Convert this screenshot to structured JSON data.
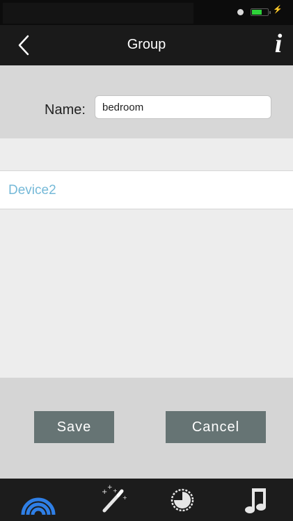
{
  "header": {
    "title": "Group",
    "back_icon": "chevron-left-icon",
    "info_glyph": "i"
  },
  "form": {
    "name_label": "Name:",
    "name_value": "bedroom"
  },
  "devices": [
    {
      "label": "Device2"
    }
  ],
  "actions": {
    "save_label": "Save",
    "cancel_label": "Cancel"
  },
  "tabs": [
    {
      "icon": "rainbow-icon",
      "active": true
    },
    {
      "icon": "magic-wand-icon",
      "active": false
    },
    {
      "icon": "timer-icon",
      "active": false
    },
    {
      "icon": "music-note-icon",
      "active": false
    }
  ],
  "colors": {
    "accent": "#2f7fe6",
    "device_text": "#75b9d8",
    "button": "#667474",
    "battery": "#2ed13a"
  }
}
